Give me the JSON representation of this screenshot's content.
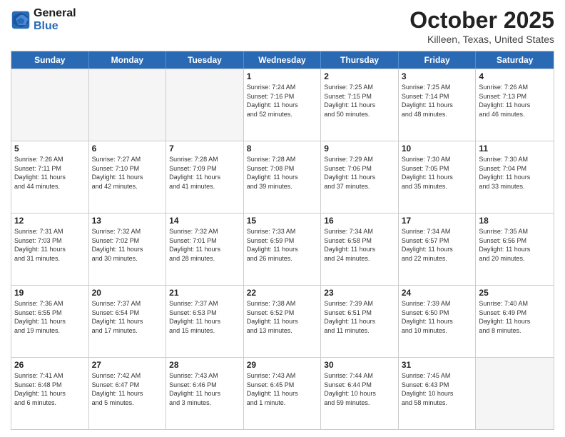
{
  "header": {
    "logo_line1": "General",
    "logo_line2": "Blue",
    "month": "October 2025",
    "location": "Killeen, Texas, United States"
  },
  "weekdays": [
    "Sunday",
    "Monday",
    "Tuesday",
    "Wednesday",
    "Thursday",
    "Friday",
    "Saturday"
  ],
  "rows": [
    [
      {
        "day": "",
        "content": ""
      },
      {
        "day": "",
        "content": ""
      },
      {
        "day": "",
        "content": ""
      },
      {
        "day": "1",
        "content": "Sunrise: 7:24 AM\nSunset: 7:16 PM\nDaylight: 11 hours\nand 52 minutes."
      },
      {
        "day": "2",
        "content": "Sunrise: 7:25 AM\nSunset: 7:15 PM\nDaylight: 11 hours\nand 50 minutes."
      },
      {
        "day": "3",
        "content": "Sunrise: 7:25 AM\nSunset: 7:14 PM\nDaylight: 11 hours\nand 48 minutes."
      },
      {
        "day": "4",
        "content": "Sunrise: 7:26 AM\nSunset: 7:13 PM\nDaylight: 11 hours\nand 46 minutes."
      }
    ],
    [
      {
        "day": "5",
        "content": "Sunrise: 7:26 AM\nSunset: 7:11 PM\nDaylight: 11 hours\nand 44 minutes."
      },
      {
        "day": "6",
        "content": "Sunrise: 7:27 AM\nSunset: 7:10 PM\nDaylight: 11 hours\nand 42 minutes."
      },
      {
        "day": "7",
        "content": "Sunrise: 7:28 AM\nSunset: 7:09 PM\nDaylight: 11 hours\nand 41 minutes."
      },
      {
        "day": "8",
        "content": "Sunrise: 7:28 AM\nSunset: 7:08 PM\nDaylight: 11 hours\nand 39 minutes."
      },
      {
        "day": "9",
        "content": "Sunrise: 7:29 AM\nSunset: 7:06 PM\nDaylight: 11 hours\nand 37 minutes."
      },
      {
        "day": "10",
        "content": "Sunrise: 7:30 AM\nSunset: 7:05 PM\nDaylight: 11 hours\nand 35 minutes."
      },
      {
        "day": "11",
        "content": "Sunrise: 7:30 AM\nSunset: 7:04 PM\nDaylight: 11 hours\nand 33 minutes."
      }
    ],
    [
      {
        "day": "12",
        "content": "Sunrise: 7:31 AM\nSunset: 7:03 PM\nDaylight: 11 hours\nand 31 minutes."
      },
      {
        "day": "13",
        "content": "Sunrise: 7:32 AM\nSunset: 7:02 PM\nDaylight: 11 hours\nand 30 minutes."
      },
      {
        "day": "14",
        "content": "Sunrise: 7:32 AM\nSunset: 7:01 PM\nDaylight: 11 hours\nand 28 minutes."
      },
      {
        "day": "15",
        "content": "Sunrise: 7:33 AM\nSunset: 6:59 PM\nDaylight: 11 hours\nand 26 minutes."
      },
      {
        "day": "16",
        "content": "Sunrise: 7:34 AM\nSunset: 6:58 PM\nDaylight: 11 hours\nand 24 minutes."
      },
      {
        "day": "17",
        "content": "Sunrise: 7:34 AM\nSunset: 6:57 PM\nDaylight: 11 hours\nand 22 minutes."
      },
      {
        "day": "18",
        "content": "Sunrise: 7:35 AM\nSunset: 6:56 PM\nDaylight: 11 hours\nand 20 minutes."
      }
    ],
    [
      {
        "day": "19",
        "content": "Sunrise: 7:36 AM\nSunset: 6:55 PM\nDaylight: 11 hours\nand 19 minutes."
      },
      {
        "day": "20",
        "content": "Sunrise: 7:37 AM\nSunset: 6:54 PM\nDaylight: 11 hours\nand 17 minutes."
      },
      {
        "day": "21",
        "content": "Sunrise: 7:37 AM\nSunset: 6:53 PM\nDaylight: 11 hours\nand 15 minutes."
      },
      {
        "day": "22",
        "content": "Sunrise: 7:38 AM\nSunset: 6:52 PM\nDaylight: 11 hours\nand 13 minutes."
      },
      {
        "day": "23",
        "content": "Sunrise: 7:39 AM\nSunset: 6:51 PM\nDaylight: 11 hours\nand 11 minutes."
      },
      {
        "day": "24",
        "content": "Sunrise: 7:39 AM\nSunset: 6:50 PM\nDaylight: 11 hours\nand 10 minutes."
      },
      {
        "day": "25",
        "content": "Sunrise: 7:40 AM\nSunset: 6:49 PM\nDaylight: 11 hours\nand 8 minutes."
      }
    ],
    [
      {
        "day": "26",
        "content": "Sunrise: 7:41 AM\nSunset: 6:48 PM\nDaylight: 11 hours\nand 6 minutes."
      },
      {
        "day": "27",
        "content": "Sunrise: 7:42 AM\nSunset: 6:47 PM\nDaylight: 11 hours\nand 5 minutes."
      },
      {
        "day": "28",
        "content": "Sunrise: 7:43 AM\nSunset: 6:46 PM\nDaylight: 11 hours\nand 3 minutes."
      },
      {
        "day": "29",
        "content": "Sunrise: 7:43 AM\nSunset: 6:45 PM\nDaylight: 11 hours\nand 1 minute."
      },
      {
        "day": "30",
        "content": "Sunrise: 7:44 AM\nSunset: 6:44 PM\nDaylight: 10 hours\nand 59 minutes."
      },
      {
        "day": "31",
        "content": "Sunrise: 7:45 AM\nSunset: 6:43 PM\nDaylight: 10 hours\nand 58 minutes."
      },
      {
        "day": "",
        "content": ""
      }
    ]
  ]
}
